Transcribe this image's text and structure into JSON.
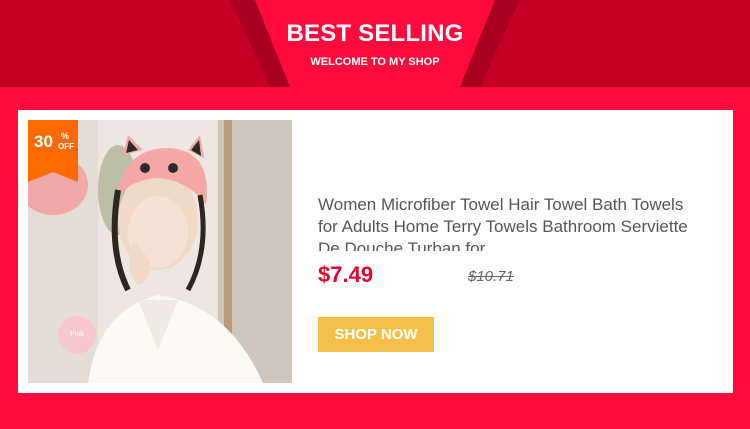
{
  "banner": {
    "title": "BEST SELLING",
    "subtitle": "WELCOME TO MY SHOP"
  },
  "product": {
    "discount_number": "30",
    "discount_percent_sign": "%",
    "discount_off": "OFF",
    "title": "Women Microfiber Towel Hair Towel Bath Towels for Adults Home Terry Towels Bathroom Serviette De Douche Turban for",
    "price": "$7.49",
    "original_price": "$10.71",
    "color_swatch_label": "Pink",
    "shop_button_label": "SHOP NOW"
  },
  "colors": {
    "page_red": "#ff0a3c",
    "header_dark_red": "#c40024",
    "badge_orange": "#ff6a00",
    "price_red": "#e4002b",
    "button_yellow": "#f4c04a"
  }
}
